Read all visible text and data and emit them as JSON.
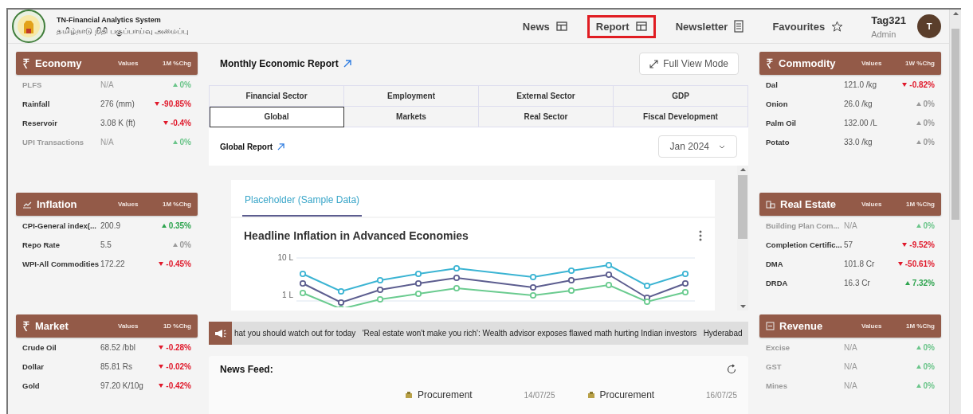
{
  "header": {
    "title": "TN-Financial Analytics System",
    "subtitle": "தமிழ்நாடு நிதி பகுப்பாய்வு அமைப்பு",
    "nav": [
      {
        "label": "News",
        "kind": "layout",
        "selected": false
      },
      {
        "label": "Report",
        "kind": "layout",
        "selected": true
      },
      {
        "label": "Newsletter",
        "kind": "document",
        "selected": false
      },
      {
        "label": "Favourites",
        "kind": "star",
        "selected": false
      }
    ],
    "user": {
      "name": "Tag321",
      "role": "Admin",
      "initial": "T"
    }
  },
  "left_panels": [
    {
      "title": "Economy",
      "kind": "rupee",
      "symbol": "₹",
      "col_values": "Values",
      "col_change": "1M %Chg",
      "rows": [
        {
          "label": "PLFS",
          "value": "N/A",
          "change": "0%",
          "negative": false,
          "neutral": false,
          "muted": true
        },
        {
          "label": "Rainfall",
          "value": "276 (mm)",
          "change": "-90.85%",
          "negative": true,
          "neutral": false,
          "muted": false
        },
        {
          "label": "Reservoir",
          "value": "3.08 K (ft)",
          "change": "-0.4%",
          "negative": true,
          "neutral": false,
          "muted": false
        },
        {
          "label": "UPI Transactions",
          "value": "N/A",
          "change": "0%",
          "negative": false,
          "neutral": false,
          "muted": true
        }
      ]
    },
    {
      "title": "Inflation",
      "kind": "chart",
      "col_values": "Values",
      "col_change": "1M %Chg",
      "rows": [
        {
          "label": "CPI-General index(...",
          "value": "200.9",
          "change": "0.35%",
          "negative": false,
          "neutral": false,
          "muted": false
        },
        {
          "label": "Repo Rate",
          "value": "5.5",
          "change": "0%",
          "negative": false,
          "neutral": true,
          "muted": false
        },
        {
          "label": "WPI-All Commodities",
          "value": "172.22",
          "change": "-0.45%",
          "negative": true,
          "neutral": false,
          "muted": false
        }
      ]
    },
    {
      "title": "Market",
      "kind": "rupee",
      "symbol": "₹",
      "col_values": "Values",
      "col_change": "1D %Chg",
      "rows": [
        {
          "label": "Crude Oil",
          "value": "68.52 /bbl",
          "change": "-0.28%",
          "negative": true,
          "neutral": false,
          "muted": false
        },
        {
          "label": "Dollar",
          "value": "85.81 Rs",
          "change": "-0.02%",
          "negative": true,
          "neutral": false,
          "muted": false
        },
        {
          "label": "Gold",
          "value": "97.20 K/10g",
          "change": "-0.42%",
          "negative": true,
          "neutral": false,
          "muted": false
        }
      ]
    }
  ],
  "center": {
    "title": "Monthly Economic Report",
    "full_view_button": "Full View Mode",
    "tabs": [
      {
        "label": "Financial Sector",
        "selected": false
      },
      {
        "label": "Employment",
        "selected": false
      },
      {
        "label": "External Sector",
        "selected": false
      },
      {
        "label": "GDP",
        "selected": false
      },
      {
        "label": "Global",
        "selected": true
      },
      {
        "label": "Markets",
        "selected": false
      },
      {
        "label": "Real Sector",
        "selected": false
      },
      {
        "label": "Fiscal Development",
        "selected": false
      }
    ],
    "report_title": "Global Report",
    "month_select": "Jan 2024",
    "chart_tab": "Placeholder (Sample Data)",
    "chart_title": "Headline Inflation in Advanced Economies",
    "y_labels": [
      "10 L",
      "1 L"
    ],
    "ticker": "hat you should watch out for today   'Real estate won't make you rich': Wealth advisor exposes flawed math hurting Indian investors   Hyderabad",
    "news_feed": {
      "title": "News Feed:",
      "items": [
        {
          "category": "Procurement",
          "date": "14/07/25"
        },
        {
          "category": "Procurement",
          "date": "16/07/25"
        }
      ]
    }
  },
  "right_panels": [
    {
      "title": "Commodity",
      "kind": "rupee",
      "symbol": "₹",
      "col_values": "Values",
      "col_change": "1W %Chg",
      "rows": [
        {
          "label": "Dal",
          "value": "121.0 /kg",
          "change": "-0.82%",
          "negative": true,
          "neutral": false,
          "muted": false
        },
        {
          "label": "Onion",
          "value": "26.0 /kg",
          "change": "0%",
          "negative": false,
          "neutral": true,
          "muted": false
        },
        {
          "label": "Palm Oil",
          "value": "132.00 /L",
          "change": "0%",
          "negative": false,
          "neutral": true,
          "muted": false
        },
        {
          "label": "Potato",
          "value": "33.0 /kg",
          "change": "0%",
          "negative": false,
          "neutral": true,
          "muted": false
        }
      ]
    },
    {
      "title": "Real Estate",
      "kind": "building",
      "col_values": "Values",
      "col_change": "1M %Chg",
      "rows": [
        {
          "label": "Building Plan Com...",
          "value": "N/A",
          "change": "0%",
          "negative": false,
          "neutral": false,
          "muted": true
        },
        {
          "label": "Completion Certific...",
          "value": "57",
          "change": "-9.52%",
          "negative": true,
          "neutral": false,
          "muted": false
        },
        {
          "label": "DMA",
          "value": "101.8 Cr",
          "change": "-50.61%",
          "negative": true,
          "neutral": false,
          "muted": false
        },
        {
          "label": "DRDA",
          "value": "16.3 Cr",
          "change": "7.32%",
          "negative": false,
          "neutral": false,
          "muted": false
        }
      ]
    },
    {
      "title": "Revenue",
      "kind": "document",
      "col_values": "Values",
      "col_change": "1M %Chg",
      "rows": [
        {
          "label": "Excise",
          "value": "N/A",
          "change": "0%",
          "negative": false,
          "neutral": false,
          "muted": true
        },
        {
          "label": "GST",
          "value": "N/A",
          "change": "0%",
          "negative": false,
          "neutral": false,
          "muted": true
        },
        {
          "label": "Mines",
          "value": "N/A",
          "change": "0%",
          "negative": false,
          "neutral": false,
          "muted": true
        }
      ]
    }
  ]
}
